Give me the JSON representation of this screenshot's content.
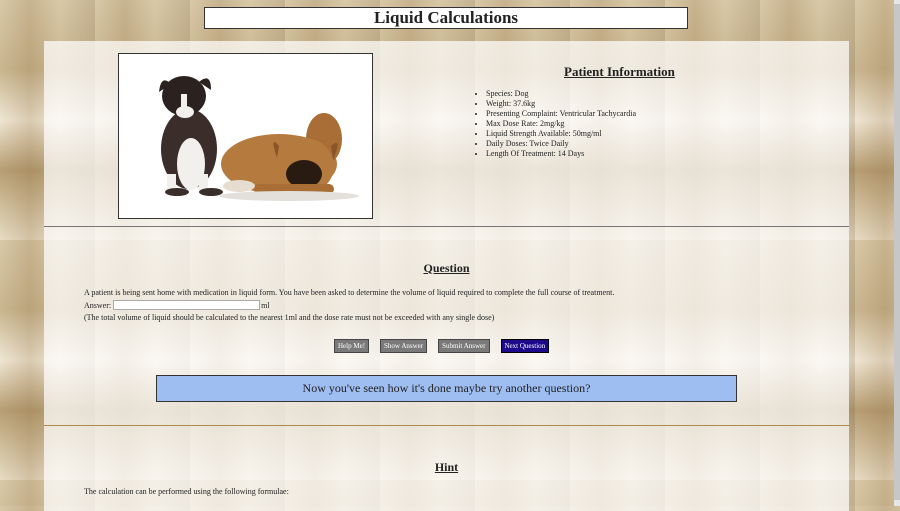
{
  "header": {
    "title": "Liquid Calculations"
  },
  "patient": {
    "heading": "Patient Information",
    "items": [
      "Species: Dog",
      "Weight: 37.6kg",
      "Presenting Complaint: Ventricular Tachycardia",
      "Max Dose Rate: 2mg/kg",
      "Liquid Strength Available: 50mg/ml",
      "Daily Doses: Twice Daily",
      "Length Of Treatment: 14 Days"
    ]
  },
  "question": {
    "heading": "Question",
    "text": "A patient is being sent home with medication in liquid form. You have been asked to determine the volume of liquid required to complete the full course of treatment.",
    "answer_label": "Answer:",
    "answer_value": "",
    "unit": "ml",
    "note": "(The total volume of liquid should be calculated to the nearest 1ml and the dose rate must not be exceeded with any single dose)"
  },
  "buttons": {
    "help": "Help Me!",
    "show": "Show Answer",
    "submit": "Submit Answer",
    "next": "Next Question"
  },
  "message": "Now you've seen how it's done maybe try another question?",
  "hint": {
    "heading": "Hint",
    "text": "The calculation can be performed using the following formulae:"
  },
  "colors": {
    "message_bg": "#9ebdf0",
    "next_button": "#1d0a8a",
    "button_gray": "#7a7a7a"
  }
}
